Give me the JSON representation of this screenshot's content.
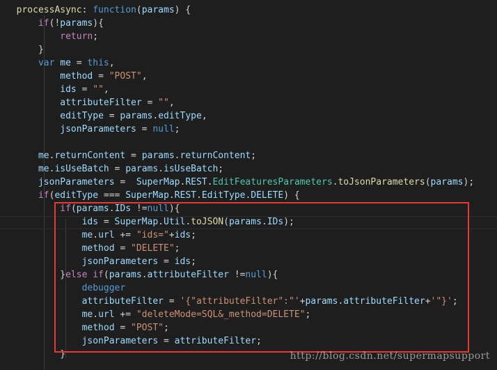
{
  "lines": [
    [
      [
        "t-punc",
        "  "
      ],
      [
        "t-fn",
        "processAsync"
      ],
      [
        "t-punc",
        ": "
      ],
      [
        "t-kw",
        "function"
      ],
      [
        "t-punc",
        "("
      ],
      [
        "t-var",
        "params"
      ],
      [
        "t-punc",
        ") {"
      ]
    ],
    [
      [
        "t-punc",
        "      "
      ],
      [
        "t-ctrl",
        "if"
      ],
      [
        "t-punc",
        "(!"
      ],
      [
        "t-var",
        "params"
      ],
      [
        "t-punc",
        "){"
      ]
    ],
    [
      [
        "t-punc",
        "          "
      ],
      [
        "t-ctrl",
        "return"
      ],
      [
        "t-punc",
        ";"
      ]
    ],
    [
      [
        "t-punc",
        "      }"
      ]
    ],
    [
      [
        "t-punc",
        "      "
      ],
      [
        "t-kw",
        "var"
      ],
      [
        "t-punc",
        " "
      ],
      [
        "t-var",
        "me"
      ],
      [
        "t-punc",
        " = "
      ],
      [
        "t-kw",
        "this"
      ],
      [
        "t-punc",
        ","
      ]
    ],
    [
      [
        "t-punc",
        "          "
      ],
      [
        "t-var",
        "method"
      ],
      [
        "t-punc",
        " = "
      ],
      [
        "t-str",
        "\"POST\""
      ],
      [
        "t-punc",
        ","
      ]
    ],
    [
      [
        "t-punc",
        "          "
      ],
      [
        "t-var",
        "ids"
      ],
      [
        "t-punc",
        " = "
      ],
      [
        "t-str",
        "\"\""
      ],
      [
        "t-punc",
        ","
      ]
    ],
    [
      [
        "t-punc",
        "          "
      ],
      [
        "t-var",
        "attributeFilter"
      ],
      [
        "t-punc",
        " = "
      ],
      [
        "t-str",
        "\"\""
      ],
      [
        "t-punc",
        ","
      ]
    ],
    [
      [
        "t-punc",
        "          "
      ],
      [
        "t-var",
        "editType"
      ],
      [
        "t-punc",
        " = "
      ],
      [
        "t-var",
        "params"
      ],
      [
        "t-punc",
        "."
      ],
      [
        "t-prop",
        "editType"
      ],
      [
        "t-punc",
        ","
      ]
    ],
    [
      [
        "t-punc",
        "          "
      ],
      [
        "t-var",
        "jsonParameters"
      ],
      [
        "t-punc",
        " = "
      ],
      [
        "t-kw",
        "null"
      ],
      [
        "t-punc",
        ";"
      ]
    ],
    [
      [
        "t-punc",
        ""
      ]
    ],
    [
      [
        "t-punc",
        "      "
      ],
      [
        "t-var",
        "me"
      ],
      [
        "t-punc",
        "."
      ],
      [
        "t-prop",
        "returnContent"
      ],
      [
        "t-punc",
        " = "
      ],
      [
        "t-var",
        "params"
      ],
      [
        "t-punc",
        "."
      ],
      [
        "t-prop",
        "returnContent"
      ],
      [
        "t-punc",
        ";"
      ]
    ],
    [
      [
        "t-punc",
        "      "
      ],
      [
        "t-var",
        "me"
      ],
      [
        "t-punc",
        "."
      ],
      [
        "t-prop",
        "isUseBatch"
      ],
      [
        "t-punc",
        " = "
      ],
      [
        "t-var",
        "params"
      ],
      [
        "t-punc",
        "."
      ],
      [
        "t-prop",
        "isUseBatch"
      ],
      [
        "t-punc",
        ";"
      ]
    ],
    [
      [
        "t-punc",
        "      "
      ],
      [
        "t-var",
        "jsonParameters"
      ],
      [
        "t-punc",
        " =  "
      ],
      [
        "t-var",
        "SuperMap"
      ],
      [
        "t-punc",
        "."
      ],
      [
        "t-prop",
        "REST"
      ],
      [
        "t-punc",
        "."
      ],
      [
        "t-type",
        "EditFeaturesParameters"
      ],
      [
        "t-punc",
        "."
      ],
      [
        "t-fn",
        "toJsonParameters"
      ],
      [
        "t-punc",
        "("
      ],
      [
        "t-var",
        "params"
      ],
      [
        "t-punc",
        ");"
      ]
    ],
    [
      [
        "t-punc",
        "      "
      ],
      [
        "t-ctrl",
        "if"
      ],
      [
        "t-punc",
        "("
      ],
      [
        "t-var",
        "editType"
      ],
      [
        "t-punc",
        " === "
      ],
      [
        "t-var",
        "SuperMap"
      ],
      [
        "t-punc",
        "."
      ],
      [
        "t-prop",
        "REST"
      ],
      [
        "t-punc",
        "."
      ],
      [
        "t-prop",
        "EditType"
      ],
      [
        "t-punc",
        "."
      ],
      [
        "t-prop",
        "DELETE"
      ],
      [
        "t-punc",
        ") {"
      ]
    ],
    [
      [
        "t-punc",
        "          "
      ],
      [
        "t-ctrl",
        "if"
      ],
      [
        "t-punc",
        "("
      ],
      [
        "t-var",
        "params"
      ],
      [
        "t-punc",
        "."
      ],
      [
        "t-prop",
        "IDs"
      ],
      [
        "t-punc",
        " !="
      ],
      [
        "t-kw",
        "null"
      ],
      [
        "t-punc",
        "){"
      ]
    ],
    [
      [
        "t-punc",
        "              "
      ],
      [
        "t-var",
        "ids"
      ],
      [
        "t-punc",
        " = "
      ],
      [
        "t-var",
        "SuperMap"
      ],
      [
        "t-punc",
        "."
      ],
      [
        "t-prop",
        "Util"
      ],
      [
        "t-punc",
        "."
      ],
      [
        "t-fn",
        "toJSON"
      ],
      [
        "t-punc",
        "("
      ],
      [
        "t-var",
        "params"
      ],
      [
        "t-punc",
        "."
      ],
      [
        "t-prop",
        "IDs"
      ],
      [
        "t-punc",
        ");"
      ]
    ],
    [
      [
        "t-punc",
        "              "
      ],
      [
        "t-var",
        "me"
      ],
      [
        "t-punc",
        "."
      ],
      [
        "t-prop",
        "url"
      ],
      [
        "t-punc",
        " += "
      ],
      [
        "t-str",
        "\"ids=\""
      ],
      [
        "t-punc",
        "+"
      ],
      [
        "t-var",
        "ids"
      ],
      [
        "t-punc",
        ";"
      ]
    ],
    [
      [
        "t-punc",
        "              "
      ],
      [
        "t-var",
        "method"
      ],
      [
        "t-punc",
        " = "
      ],
      [
        "t-str",
        "\"DELETE\""
      ],
      [
        "t-punc",
        ";"
      ]
    ],
    [
      [
        "t-punc",
        "              "
      ],
      [
        "t-var",
        "jsonParameters"
      ],
      [
        "t-punc",
        " = "
      ],
      [
        "t-var",
        "ids"
      ],
      [
        "t-punc",
        ";"
      ]
    ],
    [
      [
        "t-punc",
        "          }"
      ],
      [
        "t-ctrl",
        "else if"
      ],
      [
        "t-punc",
        "("
      ],
      [
        "t-var",
        "params"
      ],
      [
        "t-punc",
        "."
      ],
      [
        "t-prop",
        "attributeFilter"
      ],
      [
        "t-punc",
        " !="
      ],
      [
        "t-kw",
        "null"
      ],
      [
        "t-punc",
        "){"
      ]
    ],
    [
      [
        "t-punc",
        "              "
      ],
      [
        "t-kw",
        "debugger"
      ]
    ],
    [
      [
        "t-punc",
        "              "
      ],
      [
        "t-var",
        "attributeFilter"
      ],
      [
        "t-punc",
        " = "
      ],
      [
        "t-str",
        "'{\"attributeFilter\":\"'"
      ],
      [
        "t-punc",
        "+"
      ],
      [
        "t-var",
        "params"
      ],
      [
        "t-punc",
        "."
      ],
      [
        "t-prop",
        "attributeFilter"
      ],
      [
        "t-punc",
        "+"
      ],
      [
        "t-str",
        "'\"}'"
      ],
      [
        "t-punc",
        ";"
      ]
    ],
    [
      [
        "t-punc",
        "              "
      ],
      [
        "t-var",
        "me"
      ],
      [
        "t-punc",
        "."
      ],
      [
        "t-prop",
        "url"
      ],
      [
        "t-punc",
        " += "
      ],
      [
        "t-str",
        "\"deleteMode=SQL&_method=DELETE\""
      ],
      [
        "t-punc",
        ";"
      ]
    ],
    [
      [
        "t-punc",
        "              "
      ],
      [
        "t-var",
        "method"
      ],
      [
        "t-punc",
        " = "
      ],
      [
        "t-str",
        "\"POST\""
      ],
      [
        "t-punc",
        ";"
      ]
    ],
    [
      [
        "t-punc",
        "              "
      ],
      [
        "t-var",
        "jsonParameters"
      ],
      [
        "t-punc",
        " = "
      ],
      [
        "t-var",
        "attributeFilter"
      ],
      [
        "t-punc",
        ";"
      ]
    ],
    [
      [
        "t-punc",
        "          }"
      ]
    ]
  ],
  "watermark": "http://blog.csdn.net/supermapsupport"
}
